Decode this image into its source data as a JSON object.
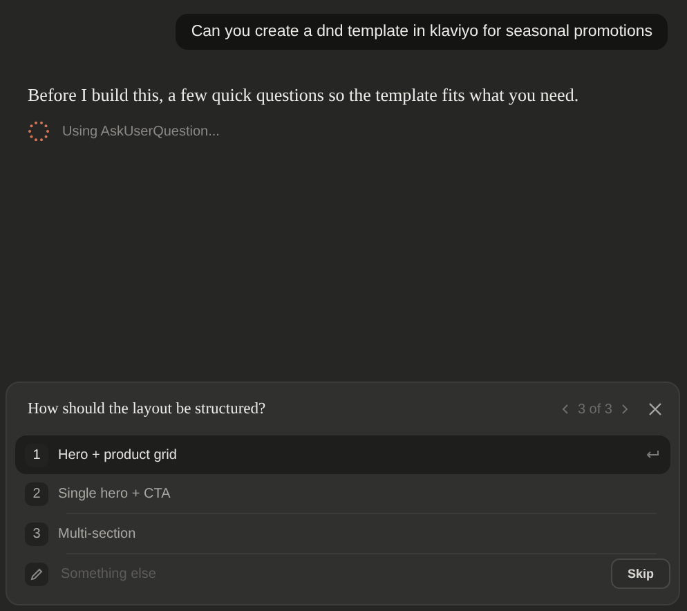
{
  "user_message": "Can you create a dnd template in klaviyo for seasonal promotions",
  "assistant_message": "Before I build this, a few quick questions so the template fits what you need.",
  "tool_status": "Using AskUserQuestion...",
  "question": {
    "text": "How should the layout be structured?",
    "pager": "3 of 3",
    "options": [
      {
        "number": "1",
        "label": "Hero + product grid",
        "selected": true
      },
      {
        "number": "2",
        "label": "Single hero + CTA",
        "selected": false
      },
      {
        "number": "3",
        "label": "Multi-section",
        "selected": false
      }
    ],
    "other": {
      "placeholder": "Something else"
    },
    "skip_button": "Skip"
  }
}
